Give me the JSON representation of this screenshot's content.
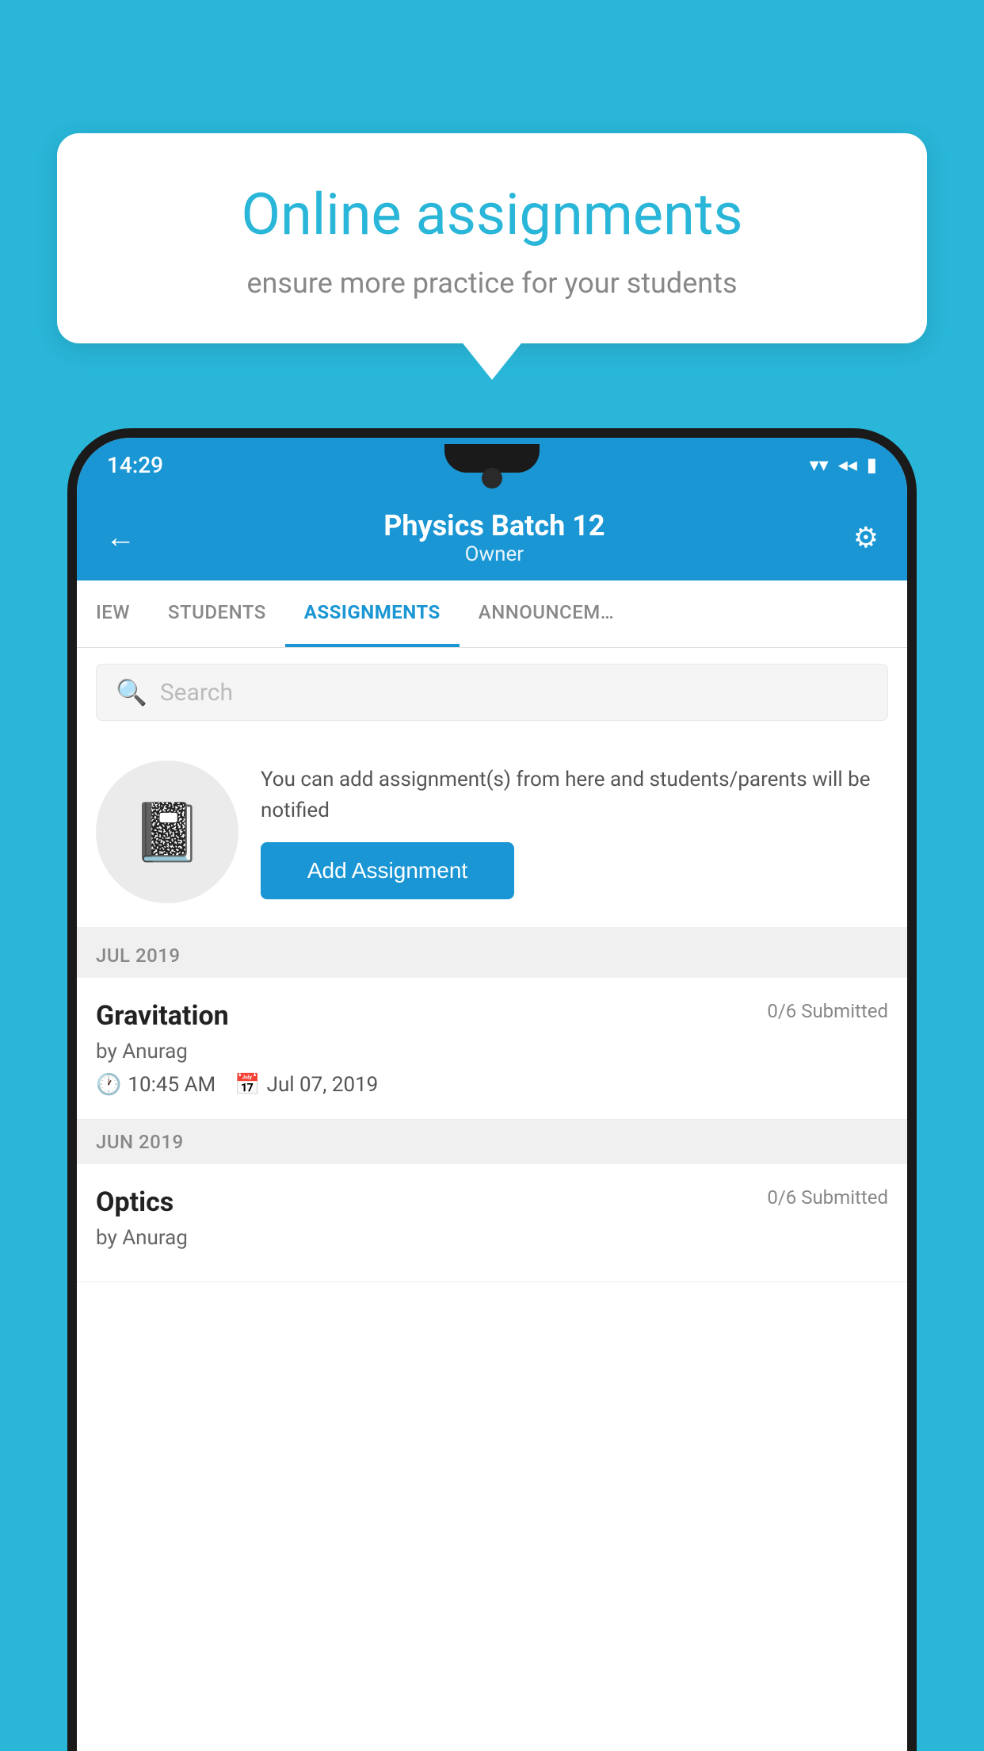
{
  "background": {
    "color": "#29b6d8"
  },
  "speech_bubble": {
    "title": "Online assignments",
    "subtitle": "ensure more practice for your students"
  },
  "status_bar": {
    "time": "14:29",
    "icons": [
      "wifi",
      "signal",
      "battery"
    ]
  },
  "header": {
    "title": "Physics Batch 12",
    "subtitle": "Owner",
    "back_label": "←",
    "settings_label": "⚙"
  },
  "tabs": [
    {
      "label": "IEW",
      "active": false
    },
    {
      "label": "STUDENTS",
      "active": false
    },
    {
      "label": "ASSIGNMENTS",
      "active": true
    },
    {
      "label": "ANNOUNCEM…",
      "active": false
    }
  ],
  "search": {
    "placeholder": "Search"
  },
  "promo": {
    "text": "You can add assignment(s) from here and students/parents will be notified",
    "button_label": "Add Assignment"
  },
  "sections": [
    {
      "month": "JUL 2019",
      "assignments": [
        {
          "title": "Gravitation",
          "submitted": "0/6 Submitted",
          "by": "by Anurag",
          "time": "10:45 AM",
          "date": "Jul 07, 2019"
        }
      ]
    },
    {
      "month": "JUN 2019",
      "assignments": [
        {
          "title": "Optics",
          "submitted": "0/6 Submitted",
          "by": "by Anurag",
          "time": "",
          "date": ""
        }
      ]
    }
  ]
}
